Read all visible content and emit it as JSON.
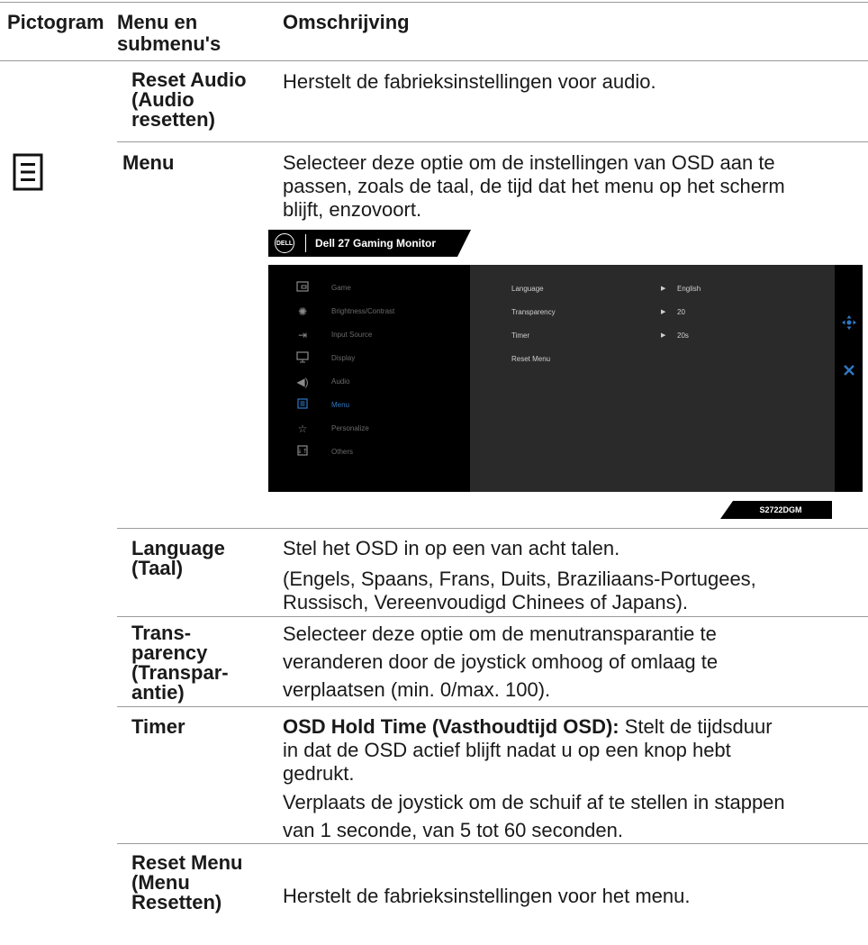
{
  "header": {
    "col1": "Pictogram",
    "col2_line1": "Menu en",
    "col2_line2": "submenu's",
    "col3": "Omschrijving"
  },
  "rows": {
    "reset_audio": {
      "term_lines": [
        "Reset Audio",
        "(Audio",
        "resetten)"
      ],
      "desc": "Herstelt de fabrieksinstellingen voor audio."
    },
    "menu": {
      "icon": "menu-list-icon",
      "term": "Menu",
      "desc_lines": [
        "Selecteer deze optie om de instellingen van OSD aan te",
        "passen, zoals de taal, de tijd dat het menu op het scherm",
        "blijft, enzovoort."
      ]
    },
    "language": {
      "term_lines": [
        "Language",
        "(Taal)"
      ],
      "desc1": "Stel het OSD in op een van acht talen.",
      "desc2_lines": [
        "(Engels, Spaans, Frans, Duits, Braziliaans-Portugees,",
        "Russisch, Vereenvoudigd Chinees of Japans)."
      ]
    },
    "transparency": {
      "term_lines": [
        "Trans-",
        "parency",
        "(Transpar-",
        "antie)"
      ],
      "desc_lines": [
        "Selecteer deze optie om de menutransparantie te",
        "veranderen door de joystick omhoog of omlaag te",
        "verplaatsen (min. 0/max. 100)."
      ]
    },
    "timer": {
      "term": "Timer",
      "desc_bold": "OSD Hold Time (Vasthoudtijd OSD):",
      "desc_first_rest": " Stelt de tijdsduur",
      "desc_lines": [
        "in dat de OSD actief blijft nadat u op een knop hebt",
        "gedrukt."
      ],
      "desc2_lines": [
        "Verplaats de joystick om de schuif af te stellen in stappen",
        "van 1 seconde, van 5 tot 60 seconden."
      ]
    },
    "reset_menu": {
      "term_lines": [
        "Reset Menu",
        "(Menu",
        "Resetten)"
      ],
      "desc": "Herstelt de fabrieksinstellingen voor het menu."
    }
  },
  "osd": {
    "logo": "DELL",
    "title": "Dell 27 Gaming Monitor",
    "model": "S2722DGM",
    "menu_items": [
      {
        "label": "Game",
        "icon": "game-icon"
      },
      {
        "label": "Brightness/Contrast",
        "icon": "brightness-icon"
      },
      {
        "label": "Input Source",
        "icon": "input-source-icon"
      },
      {
        "label": "Display",
        "icon": "display-icon"
      },
      {
        "label": "Audio",
        "icon": "audio-icon"
      },
      {
        "label": "Menu",
        "icon": "menu-icon",
        "active": true
      },
      {
        "label": "Personalize",
        "icon": "star-icon"
      },
      {
        "label": "Others",
        "icon": "others-icon"
      }
    ],
    "settings": [
      {
        "label": "Language",
        "value": "English"
      },
      {
        "label": "Transparency",
        "value": "20"
      },
      {
        "label": "Timer",
        "value": "20s"
      },
      {
        "label": "Reset Menu",
        "value": ""
      }
    ],
    "accent_color": "#2f78c4"
  }
}
